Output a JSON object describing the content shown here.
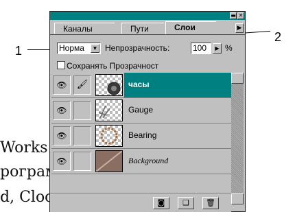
{
  "background_text": {
    "line1": "Works файлы:",
    "line2": "рограмму PhotoShop.",
    "line3": "d, Clock.psd."
  },
  "callouts": {
    "one": "1",
    "two": "2"
  },
  "panel": {
    "tabs": [
      {
        "label": "Каналы",
        "active": false
      },
      {
        "label": "Пути",
        "active": false
      },
      {
        "label": "Слои",
        "active": true
      }
    ],
    "blend_mode": "Норма",
    "opacity_label": "Непрозрачность:",
    "opacity_value": "100",
    "percent_sign": "%",
    "preserve_transparency_label": "Сохранять Прозрачност",
    "layers": [
      {
        "name": "часы",
        "selected": true
      },
      {
        "name": "Gauge",
        "selected": false
      },
      {
        "name": "Bearing",
        "selected": false
      },
      {
        "name": "Background",
        "selected": false
      }
    ],
    "colors": {
      "titlebar": "#008080",
      "selection": "#008080",
      "panel": "#c0c0c0"
    }
  }
}
